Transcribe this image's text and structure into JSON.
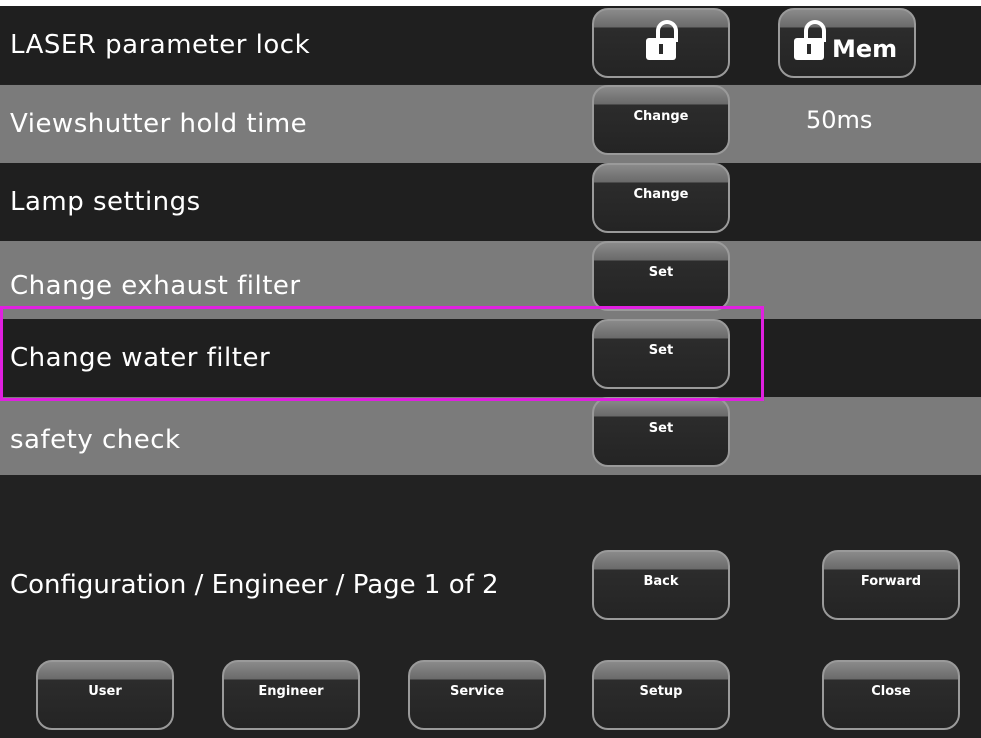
{
  "rows": [
    {
      "label": "LASER parameter lock"
    },
    {
      "label": "Viewshutter hold time",
      "button": "Change",
      "value": "50ms"
    },
    {
      "label": "Lamp settings",
      "button": "Change"
    },
    {
      "label": "Change exhaust filter",
      "button": "Set"
    },
    {
      "label": "Change water filter",
      "button": "Set"
    },
    {
      "label": "safety check",
      "button": "Set"
    }
  ],
  "lock": {
    "mem_label": "Mem",
    "icon": "lock-icon"
  },
  "navigation": {
    "breadcrumb": "Configuration / Engineer / Page 1 of 2",
    "back": "Back",
    "forward": "Forward"
  },
  "bottom_bar": {
    "user": "User",
    "engineer": "Engineer",
    "service": "Service",
    "setup": "Setup",
    "close": "Close"
  },
  "colors": {
    "highlight": "#e020e0",
    "row_dark": "#1f1f1f",
    "row_light": "#7b7b7b"
  }
}
